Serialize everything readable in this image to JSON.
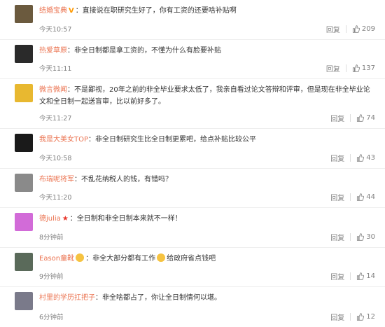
{
  "comments": [
    {
      "user": "结婚宝典",
      "badge": "V",
      "text": "：直接说在职研究生好了，你有工资的还要啥补贴啊",
      "time": "今天10:57",
      "reply": "回复",
      "likes": "209",
      "avatar_color": "#6b5a3e"
    },
    {
      "user": "热爱草原",
      "badge": "",
      "text": "：非全日制都是拿工资的，不懂为什么有脸要补贴",
      "time": "今天11:11",
      "reply": "回复",
      "likes": "137",
      "avatar_color": "#2a2a2a"
    },
    {
      "user": "微言微闻",
      "badge": "",
      "text": "：不是鄙视，20年之前的非全毕业要求太低了，我亲自看过论文答辩和评审，但是现在非全毕业论文和全日制一起送盲审，比以前好多了。",
      "time": "今天11:27",
      "reply": "回复",
      "likes": "74",
      "avatar_color": "#e8b830"
    },
    {
      "user": "我是大美女TOP",
      "badge": "",
      "text": "：非全日制研究生比全日制更累吧，给点补贴比较公平",
      "time": "今天10:58",
      "reply": "回复",
      "likes": "43",
      "avatar_color": "#1a1a1a"
    },
    {
      "user": "布瑞呢将军",
      "badge": "",
      "text": "：不乱花纳税人的钱，有错吗？",
      "time": "今天11:20",
      "reply": "回复",
      "likes": "44",
      "avatar_color": "#8a8a8a"
    },
    {
      "user": "德julia",
      "badge": "★",
      "text": "：全日制和非全日制本来就不一样！",
      "time": "8分钟前",
      "reply": "回复",
      "likes": "30",
      "avatar_color": "#d26bd8"
    },
    {
      "user": "Eason童靴",
      "badge": "",
      "text": "：非全大部分都有工作",
      "text2": "给政府省点钱吧",
      "time": "9分钟前",
      "reply": "回复",
      "likes": "14",
      "avatar_color": "#5a6a5a"
    },
    {
      "user": "村里的学历扛把子",
      "badge": "",
      "text": "：非全啥都占了，你让全日制情何以堪。",
      "time": "6分钟前",
      "reply": "回复",
      "likes": "12",
      "avatar_color": "#7a7a8a"
    }
  ],
  "icons": {
    "like": "thumbs-up-icon",
    "avatar": "user-avatar"
  }
}
